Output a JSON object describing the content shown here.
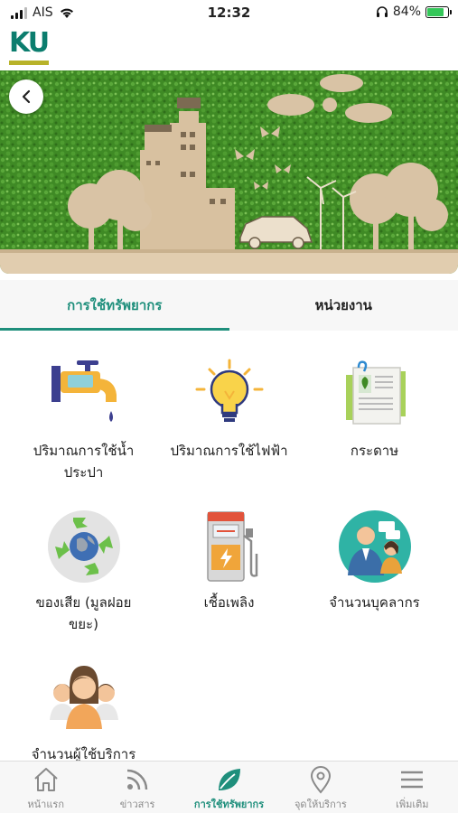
{
  "status_bar": {
    "carrier": "AIS",
    "time": "12:32",
    "battery_percent": "84%",
    "battery_level": 0.84,
    "icons": [
      "signal-icon",
      "wifi-icon",
      "headphones-icon",
      "battery-icon"
    ]
  },
  "header": {
    "logo_text": "KU",
    "logo_color": "#0b7d6e",
    "logo_bar_color": "#b8b32a"
  },
  "banner": {
    "back_icon": "chevron-left-icon"
  },
  "tabs": [
    {
      "label": "การใช้ทรัพยากร",
      "active": true
    },
    {
      "label": "หน่วยงาน",
      "active": false
    }
  ],
  "accent_color": "#1f8f7c",
  "tiles": [
    {
      "label": "ปริมาณการใช้น้ำประปา",
      "icon": "water-tap-icon"
    },
    {
      "label": "ปริมาณการใช้ไฟฟ้า",
      "icon": "light-bulb-icon"
    },
    {
      "label": "กระดาษ",
      "icon": "paper-icon"
    },
    {
      "label": "ของเสีย (มูลฝอย ขยะ)",
      "icon": "recycle-globe-icon"
    },
    {
      "label": "เชื้อเพลิง",
      "icon": "fuel-pump-icon"
    },
    {
      "label": "จำนวนบุคลากร",
      "icon": "staff-icon"
    },
    {
      "label": "จำนวนผู้ใช้บริการ",
      "icon": "users-group-icon"
    }
  ],
  "bottom_nav": [
    {
      "label": "หน้าแรก",
      "icon": "home-icon",
      "active": false
    },
    {
      "label": "ข่าวสาร",
      "icon": "rss-icon",
      "active": false
    },
    {
      "label": "การใช้ทรัพยากร",
      "icon": "leaf-icon",
      "active": true
    },
    {
      "label": "จุดให้บริการ",
      "icon": "location-pin-icon",
      "active": false
    },
    {
      "label": "เพิ่มเติม",
      "icon": "menu-icon",
      "active": false
    }
  ]
}
